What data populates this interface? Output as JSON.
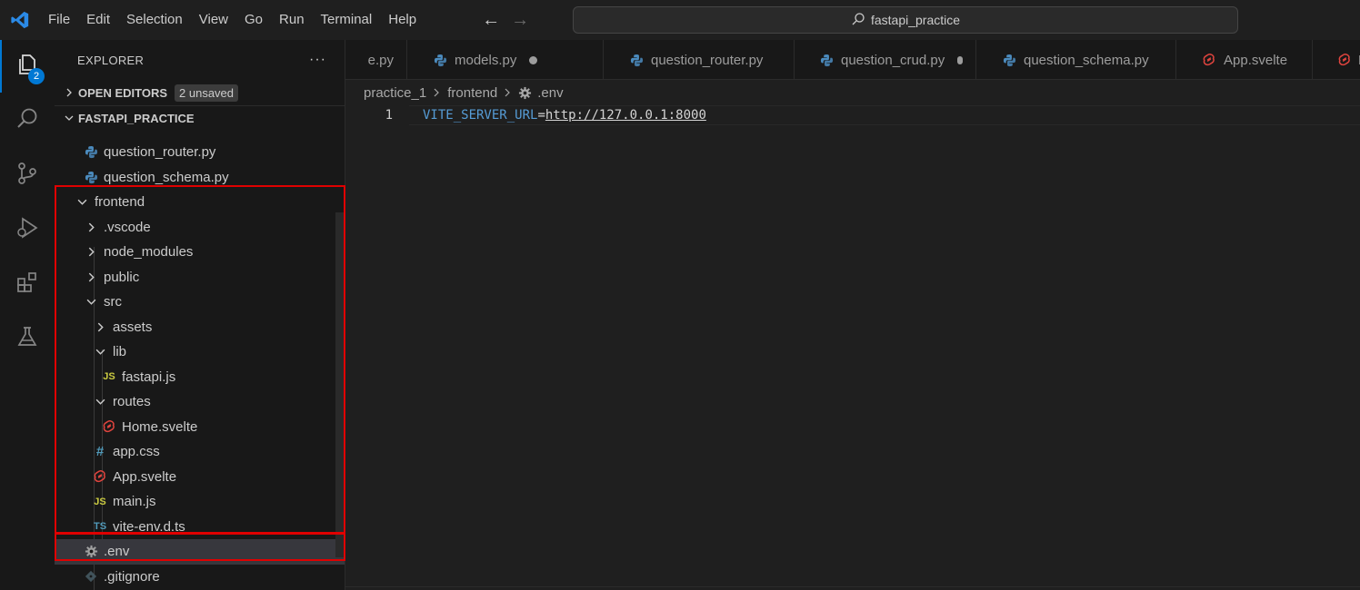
{
  "titlebar": {
    "menus": [
      "File",
      "Edit",
      "Selection",
      "View",
      "Go",
      "Run",
      "Terminal",
      "Help"
    ],
    "search_text": "fastapi_practice"
  },
  "activity": {
    "explorer_badge": "2"
  },
  "sidebar": {
    "title": "EXPLORER",
    "more": "···",
    "open_editors_label": "OPEN EDITORS",
    "unsaved_badge": "2 unsaved",
    "folder_label": "FASTAPI_PRACTICE",
    "tree": [
      {
        "label": "question_router.py",
        "icon": "python-icon",
        "type": "file",
        "depth": 2
      },
      {
        "label": "question_schema.py",
        "icon": "python-icon",
        "type": "file",
        "depth": 2
      },
      {
        "label": "frontend",
        "icon": "",
        "type": "folder-open",
        "depth": 1
      },
      {
        "label": ".vscode",
        "icon": "",
        "type": "folder-closed",
        "depth": 2
      },
      {
        "label": "node_modules",
        "icon": "",
        "type": "folder-closed",
        "depth": 2
      },
      {
        "label": "public",
        "icon": "",
        "type": "folder-closed",
        "depth": 2
      },
      {
        "label": "src",
        "icon": "",
        "type": "folder-open",
        "depth": 2
      },
      {
        "label": "assets",
        "icon": "",
        "type": "folder-closed",
        "depth": 3
      },
      {
        "label": "lib",
        "icon": "",
        "type": "folder-open",
        "depth": 3
      },
      {
        "label": "fastapi.js",
        "icon": "js-icon",
        "type": "file",
        "depth": 4
      },
      {
        "label": "routes",
        "icon": "",
        "type": "folder-open",
        "depth": 3
      },
      {
        "label": "Home.svelte",
        "icon": "svelte-icon",
        "type": "file",
        "depth": 4
      },
      {
        "label": "app.css",
        "icon": "css-hash-icon",
        "type": "file",
        "depth": 3
      },
      {
        "label": "App.svelte",
        "icon": "svelte-icon",
        "type": "file",
        "depth": 3
      },
      {
        "label": "main.js",
        "icon": "js-icon",
        "type": "file",
        "depth": 3
      },
      {
        "label": "vite-env.d.ts",
        "icon": "ts-icon",
        "type": "file",
        "depth": 3
      },
      {
        "label": ".env",
        "icon": "gear-icon",
        "type": "file",
        "depth": 2,
        "selected": true
      },
      {
        "label": ".gitignore",
        "icon": "git-icon",
        "type": "file",
        "depth": 2
      }
    ]
  },
  "tabs": [
    {
      "label": "e.py",
      "icon": "",
      "dirty": false
    },
    {
      "label": "models.py",
      "icon": "python-icon",
      "dirty": true
    },
    {
      "label": "question_router.py",
      "icon": "python-icon",
      "dirty": false
    },
    {
      "label": "question_crud.py",
      "icon": "python-icon",
      "dirty": true
    },
    {
      "label": "question_schema.py",
      "icon": "python-icon",
      "dirty": false
    },
    {
      "label": "App.svelte",
      "icon": "svelte-icon",
      "dirty": false
    },
    {
      "label": "Home.svelte",
      "icon": "svelte-icon",
      "dirty": false
    }
  ],
  "breadcrumb": {
    "parts": [
      "practice_1",
      "frontend",
      ".env"
    ]
  },
  "editor": {
    "line_number": "1",
    "key": "VITE_SERVER_URL",
    "eq": "=",
    "value": "http://127.0.0.1:8000"
  },
  "colors": {
    "accent": "#0078d4",
    "highlight_box": "#e00000",
    "python": "#4b8bbe",
    "svelte": "#e0443e",
    "js": "#cbcb41",
    "css": "#519aba",
    "ts": "#519aba"
  }
}
